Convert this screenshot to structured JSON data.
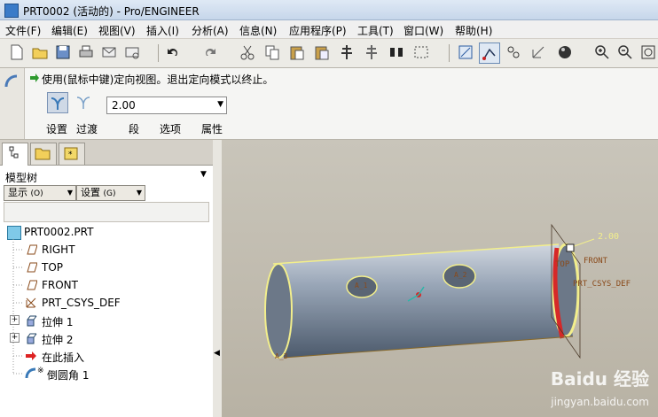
{
  "window": {
    "title": "PRT0002 (活动的) - Pro/ENGINEER"
  },
  "menu": [
    "文件(F)",
    "编辑(E)",
    "视图(V)",
    "插入(I)",
    "分析(A)",
    "信息(N)",
    "应用程序(P)",
    "工具(T)",
    "窗口(W)",
    "帮助(H)"
  ],
  "dashboard": {
    "message": "使用(鼠标中键)定向视图。退出定向模式以终止。",
    "dimension_value": "2.00",
    "tabs": [
      "设置",
      "过渡",
      "段",
      "选项",
      "属性"
    ]
  },
  "model_tree": {
    "header": "模型树",
    "show_button": "显示",
    "show_shortcut": "(O)",
    "settings_button": "设置",
    "settings_shortcut": "(G)",
    "items": [
      "PRT0002.PRT",
      "RIGHT",
      "TOP",
      "FRONT",
      "PRT_CSYS_DEF",
      "拉伸 1",
      "拉伸 2",
      "在此插入",
      "倒圆角 1"
    ]
  },
  "viewport": {
    "dim_label": "2.00",
    "labels": [
      "FRONT",
      "TOP",
      "PRT_CSYS_DEF",
      "A_1",
      "A_2",
      "A_3"
    ]
  },
  "watermark": {
    "brand": "Baidu 经验",
    "url": "jingyan.baidu.com"
  }
}
